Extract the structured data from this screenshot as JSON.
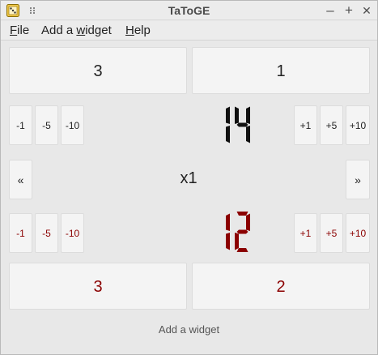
{
  "window": {
    "title": "TaToGE",
    "controls": {
      "minimize": "–",
      "maximize": "+",
      "close": "✕"
    }
  },
  "menu": [
    {
      "label": "File",
      "mnemonic": "F"
    },
    {
      "label": "Add a widget",
      "mnemonic": "w"
    },
    {
      "label": "Help",
      "mnemonic": "H"
    }
  ],
  "top_counters": [
    "3",
    "1"
  ],
  "player1": {
    "decrement_buttons": [
      "-1",
      "-5",
      "-10"
    ],
    "increment_buttons": [
      "+1",
      "+5",
      "+10"
    ],
    "score": 14,
    "score_color": "#111111"
  },
  "multiplier": {
    "prev": "«",
    "value": "x1",
    "next": "»"
  },
  "player2": {
    "decrement_buttons": [
      "-1",
      "-5",
      "-10"
    ],
    "increment_buttons": [
      "+1",
      "+5",
      "+10"
    ],
    "score": 12,
    "score_color": "#8b0000"
  },
  "bottom_counters": [
    "3",
    "2"
  ],
  "add_widget_label": "Add a widget"
}
